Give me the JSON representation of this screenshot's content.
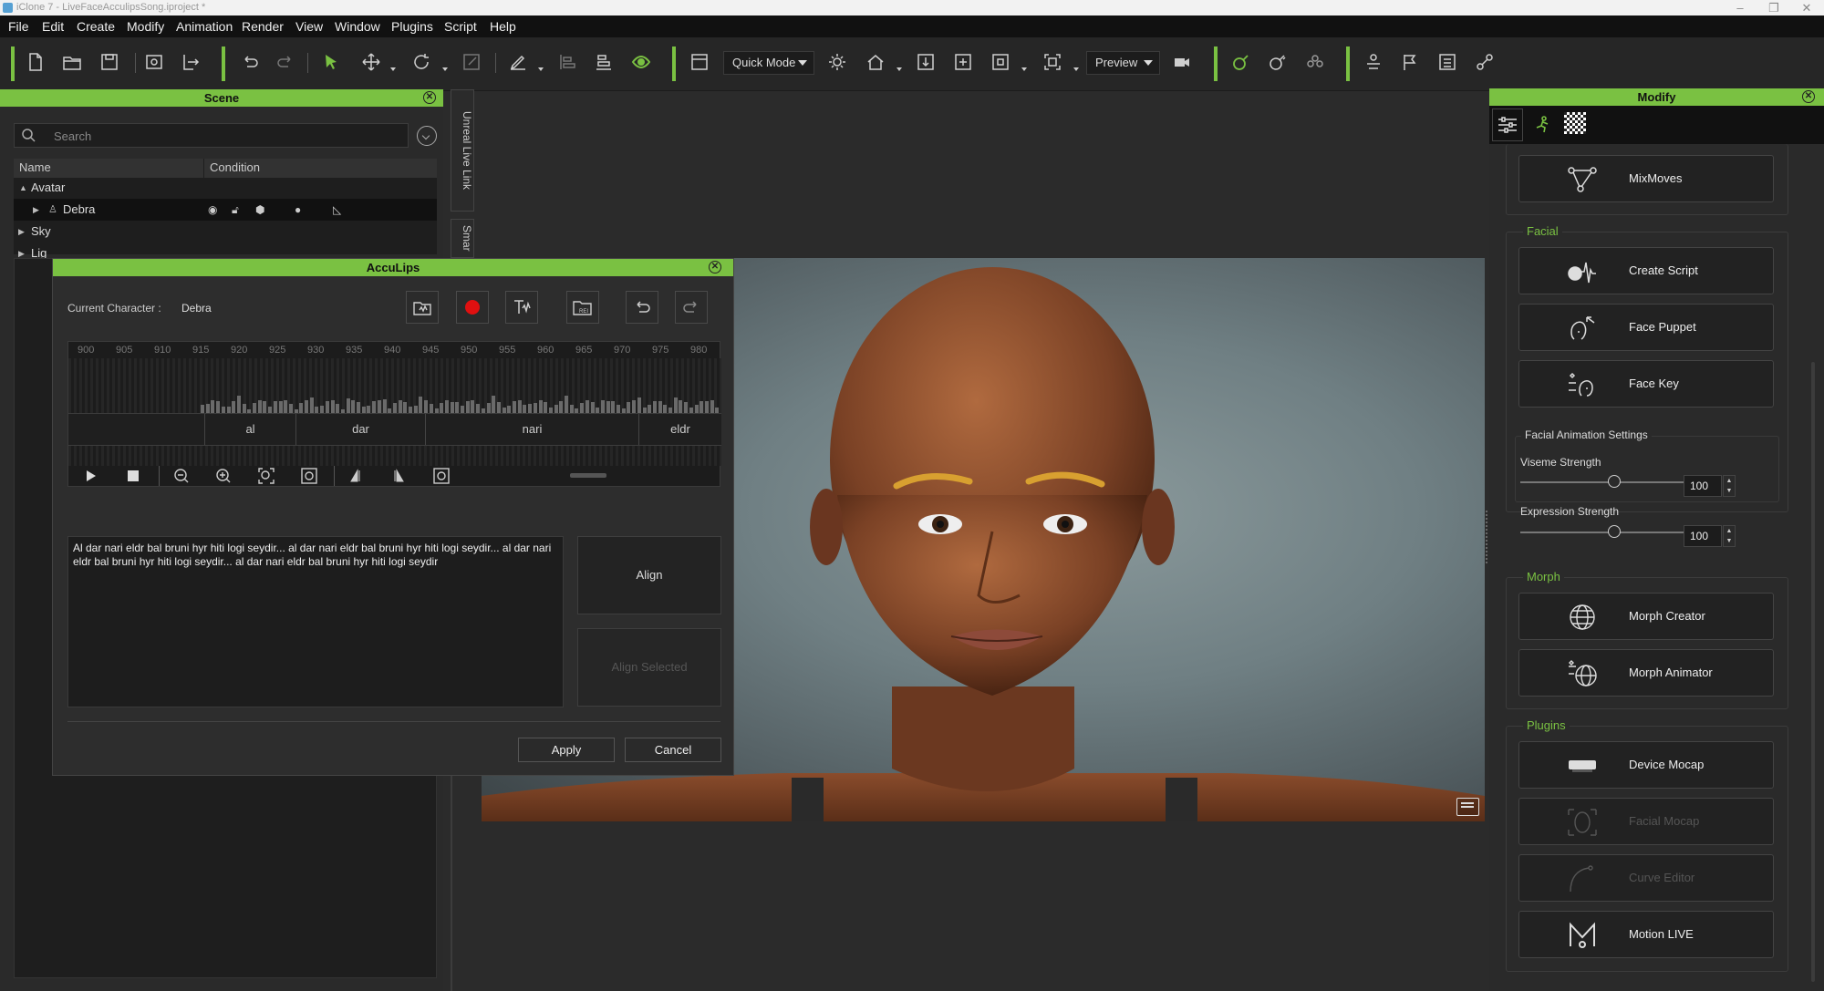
{
  "window": {
    "title": "iClone 7 - LiveFaceAcculipsSong.iproject *"
  },
  "menu": [
    "File",
    "Edit",
    "Create",
    "Modify",
    "Animation",
    "Render",
    "View",
    "Window",
    "Plugins",
    "Script",
    "Help"
  ],
  "toolbar": {
    "mode_label": "Quick Mode",
    "preview_label": "Preview"
  },
  "scene": {
    "title": "Scene",
    "search_placeholder": "Search",
    "col_name": "Name",
    "col_condition": "Condition",
    "rows": [
      "Avatar",
      "Debra",
      "Sky",
      "Lig"
    ]
  },
  "side_tabs": {
    "live_link": "Unreal Live Link",
    "smart": "Smar"
  },
  "acculips": {
    "title": "AccuLips",
    "current_label": "Current Character :",
    "current_value": "Debra",
    "ruler": [
      "900",
      "905",
      "910",
      "915",
      "920",
      "925",
      "930",
      "935",
      "940",
      "945",
      "950",
      "955",
      "960",
      "965",
      "970",
      "975",
      "980"
    ],
    "words": [
      "al",
      "dar",
      "nari",
      "eldr"
    ],
    "text": "Al dar nari eldr bal bruni hyr hiti logi seydir... al dar nari eldr bal bruni hyr hiti logi seydir... al dar nari eldr bal bruni hyr hiti logi seydir... al dar nari eldr bal bruni hyr hiti logi seydir",
    "align_label": "Align",
    "align_selected_label": "Align Selected",
    "apply_label": "Apply",
    "cancel_label": "Cancel"
  },
  "modify": {
    "title": "Modify",
    "mixmoves": "MixMoves",
    "facial": {
      "label": "Facial",
      "create_script": "Create Script",
      "face_puppet": "Face Puppet",
      "face_key": "Face Key"
    },
    "settings": {
      "label": "Facial Animation Settings",
      "viseme_label": "Viseme Strength",
      "viseme_value": "100",
      "viseme_level": 0.5,
      "expression_label": "Expression Strength",
      "expression_value": "100",
      "expression_level": 0.5
    },
    "morph": {
      "label": "Morph",
      "creator": "Morph Creator",
      "animator": "Morph Animator"
    },
    "plugins": {
      "label": "Plugins",
      "device_mocap": "Device Mocap",
      "facial_mocap": "Facial Mocap",
      "curve_editor": "Curve Editor",
      "motion_live": "Motion LIVE"
    }
  },
  "colors": {
    "accent": "#7ac142",
    "record": "#e01010"
  }
}
